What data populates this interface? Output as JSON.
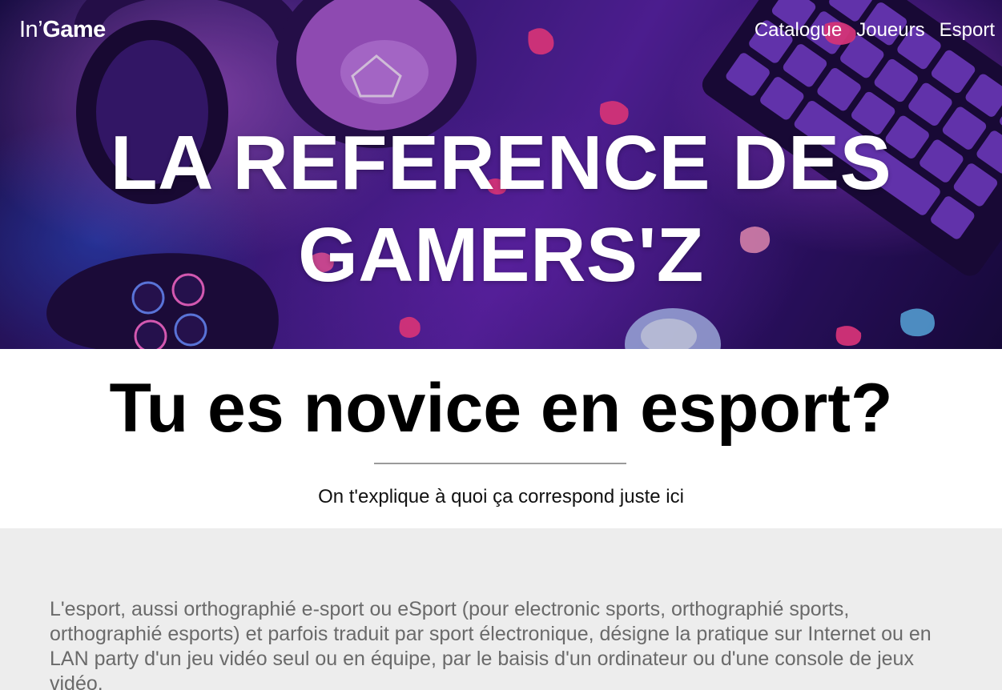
{
  "header": {
    "logo_prefix": "In’",
    "logo_bold": "Game",
    "nav": [
      {
        "label": "Catalogue"
      },
      {
        "label": "Joueurs"
      },
      {
        "label": "Esport"
      }
    ]
  },
  "hero": {
    "title": "LA REFERENCE DES GAMERS'Z"
  },
  "intro": {
    "heading": "Tu es novice en esport?",
    "subtitle": "On t'explique à quoi ça correspond juste ici"
  },
  "content": {
    "paragraph": "L'esport, aussi orthographié e-sport ou eSport (pour electronic sports, orthographié sports, orthographié esports) et parfois traduit par sport électronique, désigne la pratique sur Internet ou en LAN party d'un jeu vidéo seul ou en équipe, par le baisis d'un ordinateur ou d'une console de jeux vidéo."
  },
  "colors": {
    "hero_purple": "#5a23a6",
    "hero_blue": "#2e56e0",
    "accent_pink": "#ff3d8b",
    "content_bg": "#ededed",
    "content_text": "#6a6a6a"
  },
  "icons": [
    "headset-icon",
    "keyboard-icon",
    "gamepad-icon",
    "mouse-icon"
  ]
}
